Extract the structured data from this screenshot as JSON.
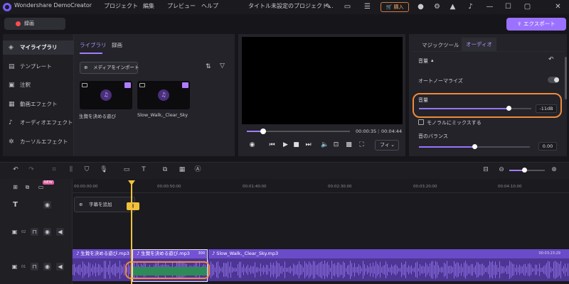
{
  "titlebar": {
    "app_name": "Wondershare DemoCreator",
    "menus": [
      "プロジェクト",
      "編集",
      "プレビュー",
      "ヘルプ"
    ],
    "project_title": "タイトル未設定のプロジェクト...",
    "buy_label": "購入"
  },
  "toolbar": {
    "record_label": "録画",
    "export_label": "エクスポート"
  },
  "sidebar": {
    "items": [
      {
        "label": "マイライブラリ",
        "icon": "library-icon"
      },
      {
        "label": "テンプレート",
        "icon": "template-icon"
      },
      {
        "label": "注釈",
        "icon": "annotation-icon"
      },
      {
        "label": "動画エフェクト",
        "icon": "video-effect-icon"
      },
      {
        "label": "オーディオエフェクト",
        "icon": "audio-effect-icon"
      },
      {
        "label": "カーソルエフェクト",
        "icon": "cursor-effect-icon"
      }
    ]
  },
  "library": {
    "tabs": [
      "ライブラリ",
      "録画"
    ],
    "import_label": "メディアをインポート",
    "media": [
      {
        "name": "生贄を決める遊び"
      },
      {
        "name": "Slow_Walk,_Clear_Sky"
      }
    ]
  },
  "preview": {
    "current_time": "00:00:35",
    "total_time": "00:04:44",
    "fit_label": "フィ",
    "progress": 0.16
  },
  "properties": {
    "tabs": [
      "マジックツール",
      "オーディオ"
    ],
    "section_title": "音量",
    "auto_normalize_label": "オートノーマライズ",
    "volume_label": "音量",
    "volume_value": "-11dB",
    "volume_level": 0.8,
    "mono_mix_label": "モノラルにミックスする",
    "balance_label": "音のバランス",
    "balance_value": "0.00",
    "balance_level": 0.5
  },
  "timeline": {
    "new_badge": "NEW",
    "ruler": [
      "00:00:00:00",
      "00:00:50:00",
      "00:01:40:00",
      "00:02:30:00",
      "00:03:20:00",
      "00:04:10:00"
    ],
    "add_caption_label": "字幕を追加",
    "track_numbers": [
      "02",
      "01"
    ],
    "clips": [
      {
        "name": "生贄を決める遊び.mp3"
      },
      {
        "name": "生贄を決める遊び.mp3",
        "badge": "300"
      },
      {
        "name": "Slow_Walk,_Clear_Sky.mp3",
        "time": "00:03:23:29"
      }
    ],
    "zoom_level": 0.45
  },
  "colors": {
    "accent": "#9b72ff",
    "highlight": "#f08a3c",
    "playhead": "#f2c13a"
  }
}
